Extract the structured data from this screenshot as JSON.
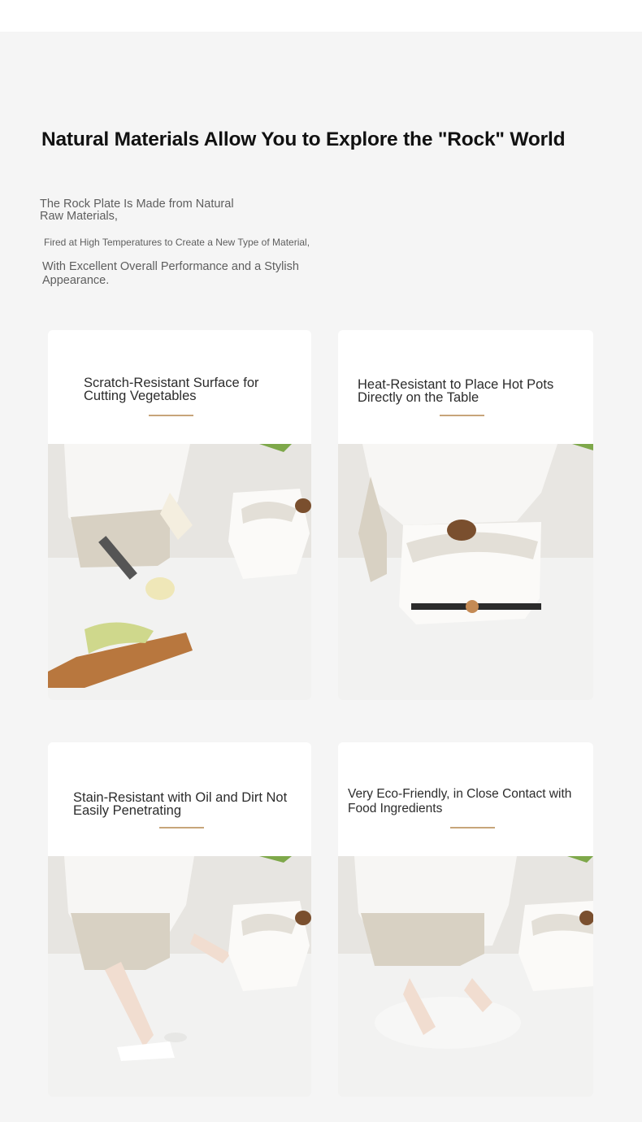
{
  "section": {
    "title": "Natural Materials Allow You to Explore the \"Rock\" World",
    "intro": {
      "line1": "The Rock Plate Is Made from Natural Raw Materials,",
      "line2": "Fired at High Temperatures to Create a New Type of Material,",
      "line3": "With Excellent Overall Performance and a Stylish Appearance."
    }
  },
  "features": [
    {
      "title": "Scratch-Resistant Surface for Cutting Vegetables",
      "icon": "cutting-vegetables-photo"
    },
    {
      "title": "Heat-Resistant to Place Hot Pots Directly on the Table",
      "icon": "hot-pot-on-table-photo"
    },
    {
      "title": "Stain-Resistant with Oil and Dirt Not Easily Penetrating",
      "icon": "wiping-table-photo"
    },
    {
      "title": "Very Eco-Friendly, in Close Contact with Food Ingredients",
      "icon": "kneading-dough-photo"
    }
  ],
  "colors": {
    "background": "#f5f5f5",
    "card": "#ffffff",
    "accent_rule": "#c7a57a",
    "title_text": "#111111",
    "body_text": "#5e5e5e"
  }
}
